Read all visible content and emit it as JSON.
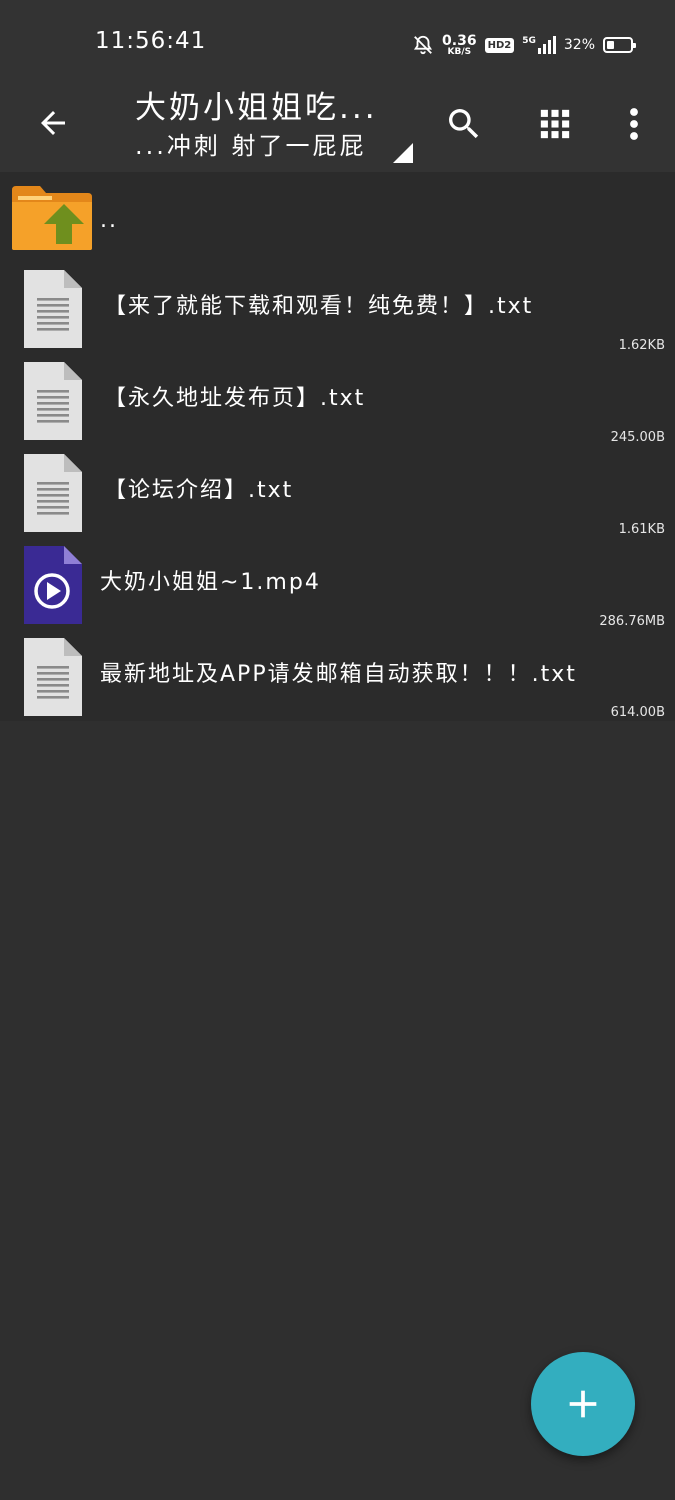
{
  "status_bar": {
    "time": "11:56:41",
    "net_speed_value": "0.36",
    "net_speed_unit": "KB/S",
    "hd_badge": "HD2",
    "network": "5G",
    "battery_percent": "32%",
    "battery_level": 0.32
  },
  "toolbar": {
    "title": "大奶小姐姐吃...",
    "subtitle": "...冲刺 射了一屁屁",
    "icons": [
      "arrow-back-icon",
      "search-icon",
      "grid-view-icon",
      "more-vert-icon"
    ]
  },
  "file_list": {
    "parent_label": "..",
    "items": [
      {
        "name": "【来了就能下载和观看！纯免费！】.txt",
        "size": "1.62KB",
        "type": "text"
      },
      {
        "name": "【永久地址发布页】.txt",
        "size": "245.00B",
        "type": "text"
      },
      {
        "name": "【论坛介绍】.txt",
        "size": "1.61KB",
        "type": "text"
      },
      {
        "name": "大奶小姐姐~1.mp4",
        "size": "286.76MB",
        "type": "video"
      },
      {
        "name": "最新地址及APP请发邮箱自动获取！！！.txt",
        "size": "614.00B",
        "type": "text"
      }
    ]
  },
  "fab": {
    "icon": "plus-icon"
  },
  "colors": {
    "background": "#2f2f2f",
    "toolbar": "#333333",
    "list_background": "#2b2b2b",
    "fab": "#33aebf",
    "folder": "#f39c21",
    "folder_arrow": "#6b8e23",
    "video_icon": "#3b2a93",
    "doc_icon": "#e0e0e0"
  }
}
